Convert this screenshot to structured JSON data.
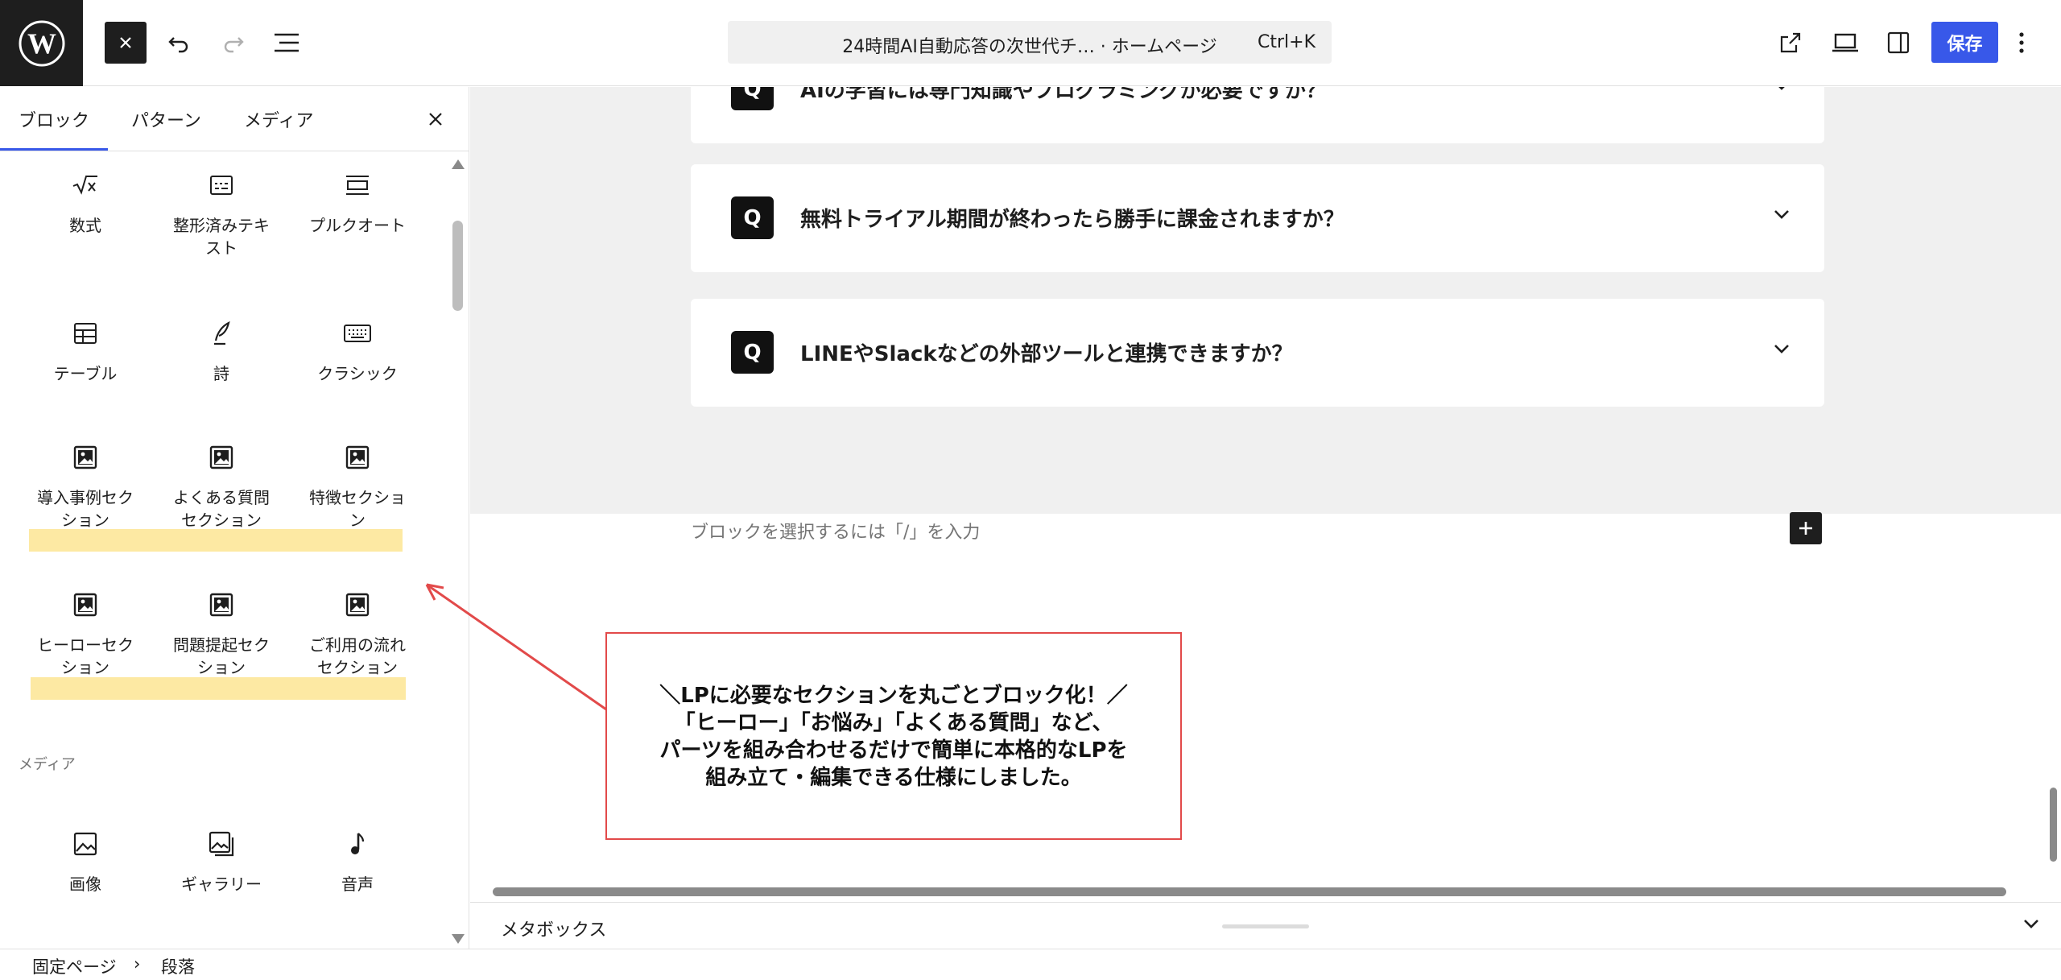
{
  "topbar": {
    "doc_title": "24時間AI自動応答の次世代チ… · ホームページ",
    "shortcut": "Ctrl+K",
    "save_label": "保存"
  },
  "inserter": {
    "tabs": [
      "ブロック",
      "パターン",
      "メディア"
    ],
    "blocks": [
      {
        "label": "数式",
        "icon": "math-icon"
      },
      {
        "label": "整形済みテキ\nスト",
        "icon": "preformatted-icon"
      },
      {
        "label": "プルクオート",
        "icon": "pullquote-icon"
      },
      {
        "label": "テーブル",
        "icon": "table-icon"
      },
      {
        "label": "詩",
        "icon": "verse-icon"
      },
      {
        "label": "クラシック",
        "icon": "keyboard-icon"
      },
      {
        "label": "導入事例セク\nション",
        "icon": "pattern-block-icon"
      },
      {
        "label": "よくある質問\nセクション",
        "icon": "pattern-block-icon"
      },
      {
        "label": "特徴セクショ\nン",
        "icon": "pattern-block-icon"
      },
      {
        "label": "ヒーローセク\nション",
        "icon": "pattern-block-icon"
      },
      {
        "label": "問題提起セク\nション",
        "icon": "pattern-block-icon"
      },
      {
        "label": "ご利用の流れ\nセクション",
        "icon": "pattern-block-icon"
      }
    ],
    "media_heading": "メディア",
    "media_blocks": [
      {
        "label": "画像",
        "icon": "image-icon"
      },
      {
        "label": "ギャラリー",
        "icon": "gallery-icon"
      },
      {
        "label": "音声",
        "icon": "audio-icon"
      }
    ]
  },
  "canvas": {
    "faq": [
      {
        "q": "Q",
        "text": "AIの学習には専門知識やプログラミングが必要ですか？"
      },
      {
        "q": "Q",
        "text": "無料トライアル期間が終わったら勝手に課金されますか？"
      },
      {
        "q": "Q",
        "text": "LINEやSlackなどの外部ツールと連携できますか？"
      }
    ],
    "placeholder": "ブロックを選択するには「/」を入力",
    "callout_lines": [
      "＼LPに必要なセクションを丸ごとブロック化！／",
      "「ヒーロー」「お悩み」「よくある質問」など、",
      "パーツを組み合わせるだけで簡単に本格的なLPを",
      "組み立て・編集できる仕様にしました。"
    ]
  },
  "metabox": {
    "label": "メタボックス"
  },
  "breadcrumb": [
    "固定ページ",
    "段落"
  ],
  "colors": {
    "accent": "#3858e9",
    "highlight": "#fde9a3",
    "callout_border": "#e24a4a",
    "arrow": "#e24a4a"
  }
}
